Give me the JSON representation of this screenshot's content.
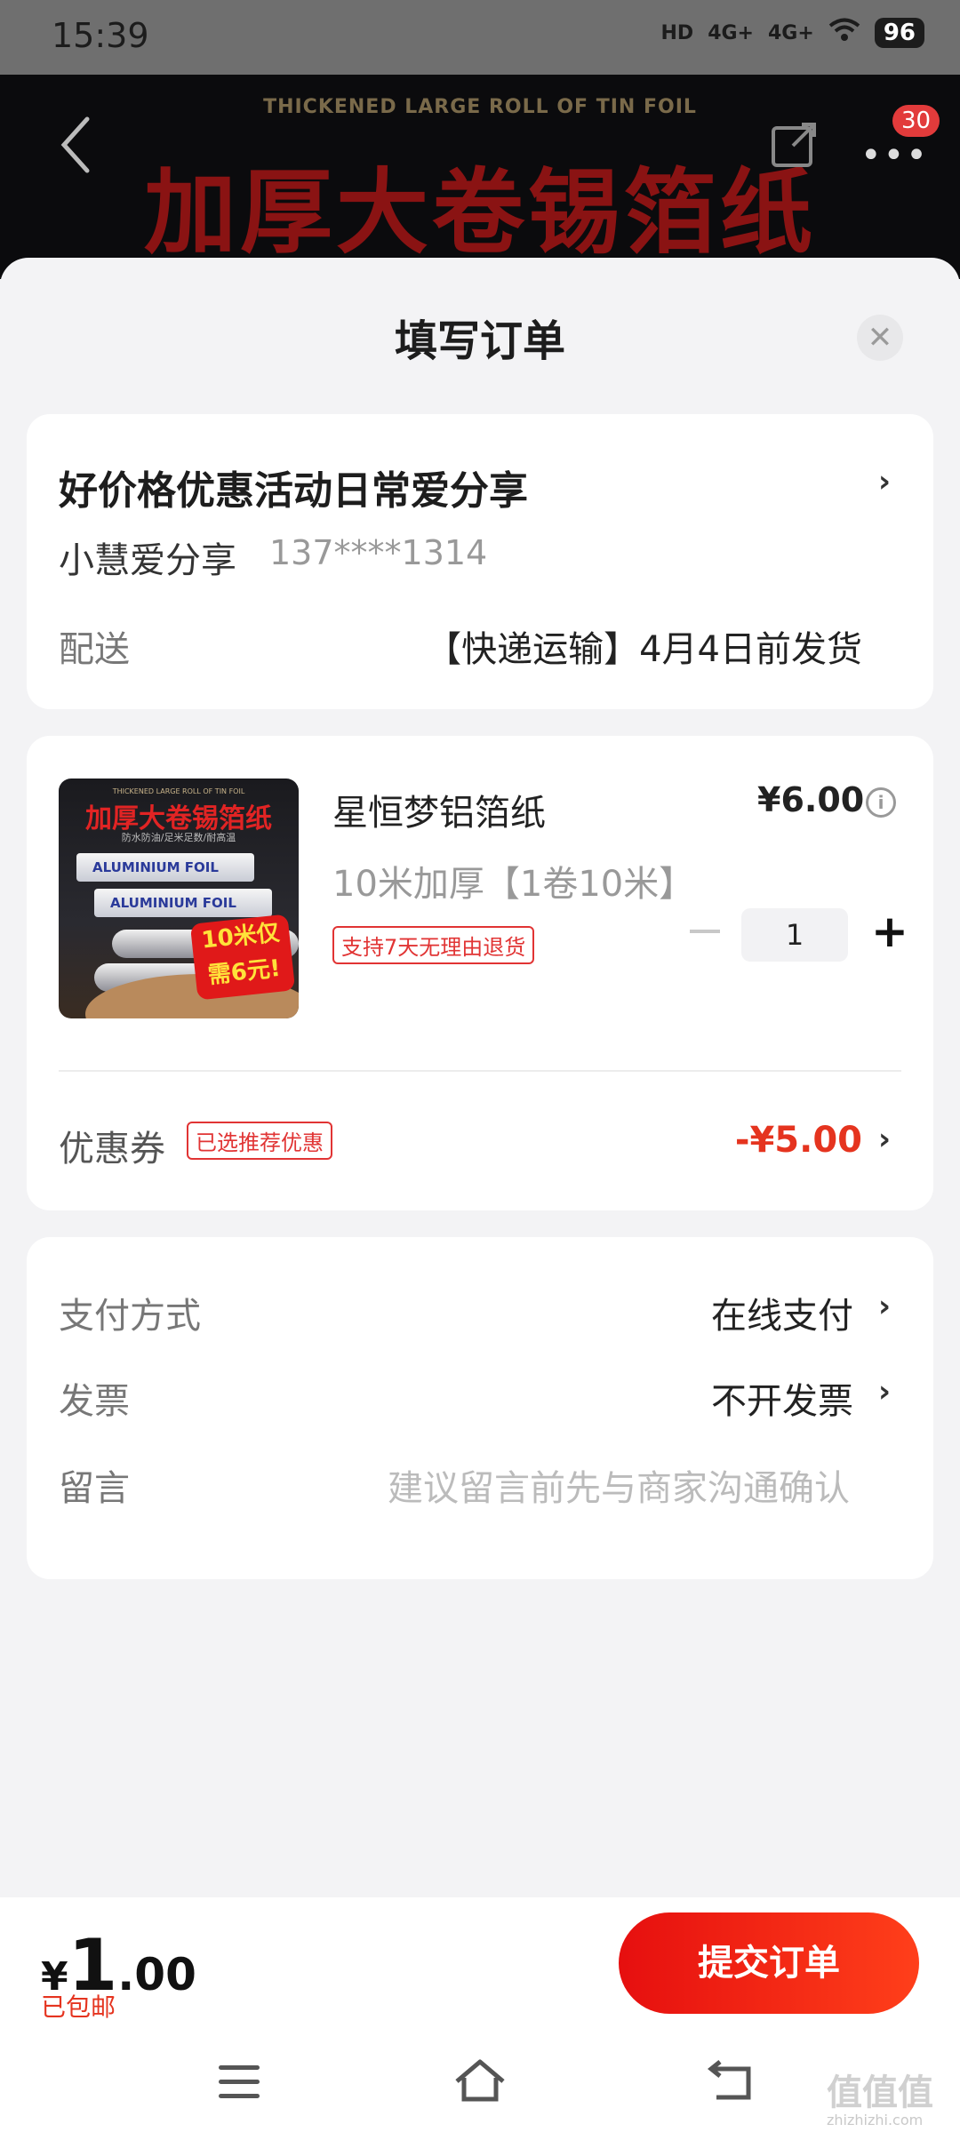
{
  "status_bar": {
    "time": "15:39",
    "net1": "4G+",
    "net2": "4G+",
    "hd": "HD",
    "battery": "96"
  },
  "banner": {
    "subtitle": "THICKENED LARGE ROLL OF TIN FOIL",
    "title": "加厚大卷锡箔纸",
    "cart_badge": "30"
  },
  "sheet": {
    "title": "填写订单",
    "close_icon": "close-icon"
  },
  "address": {
    "title": "好价格优惠活动日常爱分享",
    "name": "小慧爱分享",
    "phone": "137****1314",
    "shipping_label": "配送",
    "shipping_value": "【快递运输】4月4日前发货"
  },
  "product": {
    "image_text": {
      "top": "THICKENED LARGE ROLL OF TIN FOIL",
      "title": "加厚大卷锡箔纸",
      "sub": "防水防油/足米足数/耐高温",
      "foil": "ALUMINIUM FOIL",
      "promo": "10米仅需6元!"
    },
    "name": "星恒梦铝箔纸",
    "price": "¥6.00",
    "spec": "10米加厚【1卷10米】",
    "return_tag": "支持7天无理由退货",
    "quantity": "1",
    "plus": "+"
  },
  "coupon": {
    "label": "优惠券",
    "tag": "已选推荐优惠",
    "value": "-¥5.00"
  },
  "payment": {
    "label": "支付方式",
    "value": "在线支付"
  },
  "invoice": {
    "label": "发票",
    "value": "不开发票"
  },
  "note": {
    "label": "留言",
    "placeholder": "建议留言前先与商家沟通确认"
  },
  "footer": {
    "currency": "¥",
    "total_int": "1",
    "total_dec": ".00",
    "shipping": "已包邮",
    "submit": "提交订单"
  },
  "watermark": {
    "text": "值值值",
    "domain": "zhizhizhi.com"
  },
  "colors": {
    "accent": "#e5341f",
    "button_start": "#e60f0f",
    "button_end": "#ff3f1a"
  }
}
